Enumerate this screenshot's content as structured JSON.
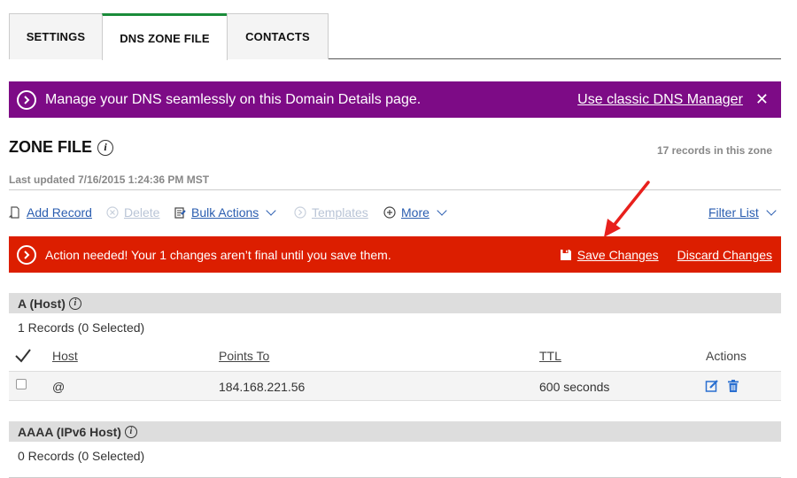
{
  "tabs": [
    {
      "label": "SETTINGS"
    },
    {
      "label": "DNS ZONE FILE"
    },
    {
      "label": "CONTACTS"
    }
  ],
  "promo_banner": {
    "message": "Manage your DNS seamlessly on this Domain Details page.",
    "link": "Use classic DNS Manager",
    "close": "✕",
    "color": "#7d0b86"
  },
  "zone": {
    "title": "ZONE FILE",
    "info": "i",
    "records_count": "17 records in this zone",
    "last_updated": "Last updated 7/16/2015 1:24:36 PM MST"
  },
  "toolbar": {
    "add_record": "Add Record",
    "delete": "Delete",
    "bulk_actions": "Bulk Actions",
    "templates": "Templates",
    "more": "More",
    "filter_list": "Filter List"
  },
  "alert": {
    "message": "Action needed! Your 1 changes aren’t final until you save them.",
    "save": "Save Changes",
    "discard": "Discard Changes",
    "color": "#dc1e00"
  },
  "sections": [
    {
      "title": "A (Host)",
      "count": "1 Records (0 Selected)",
      "columns": {
        "host": "Host",
        "points_to": "Points To",
        "ttl": "TTL",
        "actions": "Actions"
      },
      "rows": [
        {
          "host": "@",
          "points_to": "184.168.221.56",
          "ttl": "600 seconds"
        }
      ]
    },
    {
      "title": "AAAA (IPv6 Host)",
      "count": "0 Records (0 Selected)"
    }
  ],
  "icons": [
    "chevron-right-icon",
    "close-icon",
    "info-icon",
    "add-record-icon",
    "delete-icon",
    "bulk-actions-icon",
    "templates-icon",
    "plus-circle-icon",
    "chevron-down-icon",
    "floppy-disk-icon",
    "checkmark-icon",
    "edit-icon",
    "trash-icon",
    "annotation-arrow"
  ]
}
